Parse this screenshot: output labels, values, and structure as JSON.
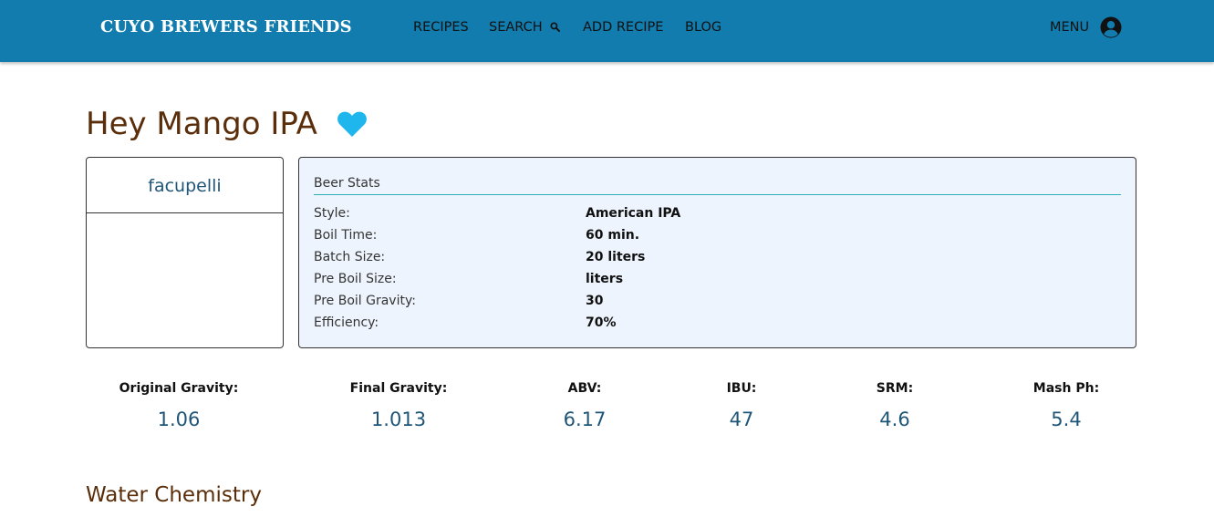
{
  "navbar": {
    "brand": "CUYO BREWERS FRIENDS",
    "links": {
      "recipes": "RECIPES",
      "search": "SEARCH",
      "add_recipe": "ADD RECIPE",
      "blog": "BLOG"
    },
    "menu": "MENU",
    "icons": {
      "search": "search-icon",
      "user": "user-circle-icon"
    },
    "background": "#117cad"
  },
  "recipe": {
    "title": "Hey Mango IPA",
    "favorite_icon": "heart-icon",
    "favorite_color": "#1fb6ee",
    "author": "facupelli"
  },
  "beer_stats": {
    "header": "Beer Stats",
    "rows": [
      {
        "label": "Style:",
        "value": "American IPA"
      },
      {
        "label": "Boil Time:",
        "value": "60 min."
      },
      {
        "label": "Batch Size:",
        "value": "20 liters"
      },
      {
        "label": "Pre Boil Size:",
        "value": "liters"
      },
      {
        "label": "Pre Boil Gravity:",
        "value": "30"
      },
      {
        "label": "Efficiency:",
        "value": "70%"
      }
    ]
  },
  "metrics": [
    {
      "label": "Original Gravity:",
      "value": "1.06"
    },
    {
      "label": "Final Gravity:",
      "value": "1.013"
    },
    {
      "label": "ABV:",
      "value": "6.17"
    },
    {
      "label": "IBU:",
      "value": "47"
    },
    {
      "label": "SRM:",
      "value": "4.6"
    },
    {
      "label": "Mash Ph:",
      "value": "5.4"
    }
  ],
  "sections": {
    "water_chemistry": "Water Chemistry"
  },
  "colors": {
    "title": "#5a2e0a",
    "accent_text": "#1f5678",
    "stats_bg": "#eef4fd",
    "divider": "#2bb0b5"
  }
}
